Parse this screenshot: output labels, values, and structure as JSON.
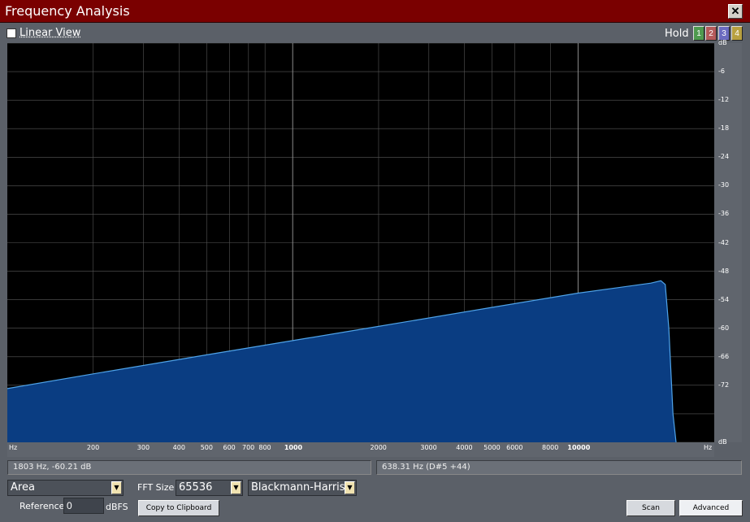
{
  "window": {
    "title": "Frequency Analysis",
    "close_glyph": "✕"
  },
  "toolbar": {
    "linear_view_label": "Linear View",
    "linear_view_checked": false,
    "hold_label": "Hold",
    "hold_buttons": [
      {
        "label": "1",
        "color": "#4f9a4f"
      },
      {
        "label": "2",
        "color": "#b55a5a"
      },
      {
        "label": "3",
        "color": "#6b6bc0"
      },
      {
        "label": "4",
        "color": "#b8a040"
      }
    ]
  },
  "chart_data": {
    "type": "area",
    "x_scale": "log",
    "x_unit": "Hz",
    "y_unit": "dB",
    "xlim": [
      100,
      30000
    ],
    "ylim": [
      -84,
      0
    ],
    "x_ticks": [
      {
        "value": 200,
        "label": "200",
        "major": false
      },
      {
        "value": 300,
        "label": "300",
        "major": false
      },
      {
        "value": 400,
        "label": "400",
        "major": false
      },
      {
        "value": 500,
        "label": "500",
        "major": false
      },
      {
        "value": 600,
        "label": "600",
        "major": false
      },
      {
        "value": 700,
        "label": "700",
        "major": false
      },
      {
        "value": 800,
        "label": "800",
        "major": false
      },
      {
        "value": 1000,
        "label": "1000",
        "major": true
      },
      {
        "value": 2000,
        "label": "2000",
        "major": false
      },
      {
        "value": 3000,
        "label": "3000",
        "major": false
      },
      {
        "value": 4000,
        "label": "4000",
        "major": false
      },
      {
        "value": 5000,
        "label": "5000",
        "major": false
      },
      {
        "value": 6000,
        "label": "6000",
        "major": false
      },
      {
        "value": 8000,
        "label": "8000",
        "major": false
      },
      {
        "value": 10000,
        "label": "10000",
        "major": true
      }
    ],
    "x_end_labels": [
      "Hz",
      "Hz"
    ],
    "y_ticks": [
      {
        "value": 0,
        "label": "dB"
      },
      {
        "value": -6,
        "label": "-6"
      },
      {
        "value": -12,
        "label": "-12"
      },
      {
        "value": -18,
        "label": "-18"
      },
      {
        "value": -24,
        "label": "-24"
      },
      {
        "value": -30,
        "label": "-30"
      },
      {
        "value": -36,
        "label": "-36"
      },
      {
        "value": -42,
        "label": "-42"
      },
      {
        "value": -48,
        "label": "-48"
      },
      {
        "value": -54,
        "label": "-54"
      },
      {
        "value": -60,
        "label": "-60"
      },
      {
        "value": -66,
        "label": "-66"
      },
      {
        "value": -72,
        "label": "-72"
      },
      {
        "value": -78,
        "label": ""
      },
      {
        "value": -84,
        "label": "dB"
      }
    ],
    "series": [
      {
        "x": [
          100,
          200,
          500,
          1000,
          2000,
          5000,
          10000,
          18000,
          19500,
          20200,
          20800,
          21500,
          22050
        ],
        "y": [
          -72.7,
          -69.6,
          -65.6,
          -62.6,
          -59.6,
          -55.6,
          -52.6,
          -50.5,
          -50.0,
          -50.8,
          -60.0,
          -78.0,
          -84.0
        ]
      }
    ],
    "fill_color": "#0a3d82",
    "line_color": "#4fa3e8",
    "grid": true,
    "background": "#000000"
  },
  "status": {
    "cursor_readout": "1803 Hz, -60.21 dB",
    "peak_readout": "638.31 Hz (D#5 +44)"
  },
  "controls": {
    "display_mode": "Area",
    "fft_size_label": "FFT Size",
    "fft_size": "65536",
    "window_function": "Blackmann-Harris",
    "reference_label": "Reference",
    "reference_value": "0",
    "reference_unit": "dBFS",
    "copy_label": "Copy to Clipboard",
    "scan_label": "Scan",
    "advanced_label": "Advanced"
  }
}
